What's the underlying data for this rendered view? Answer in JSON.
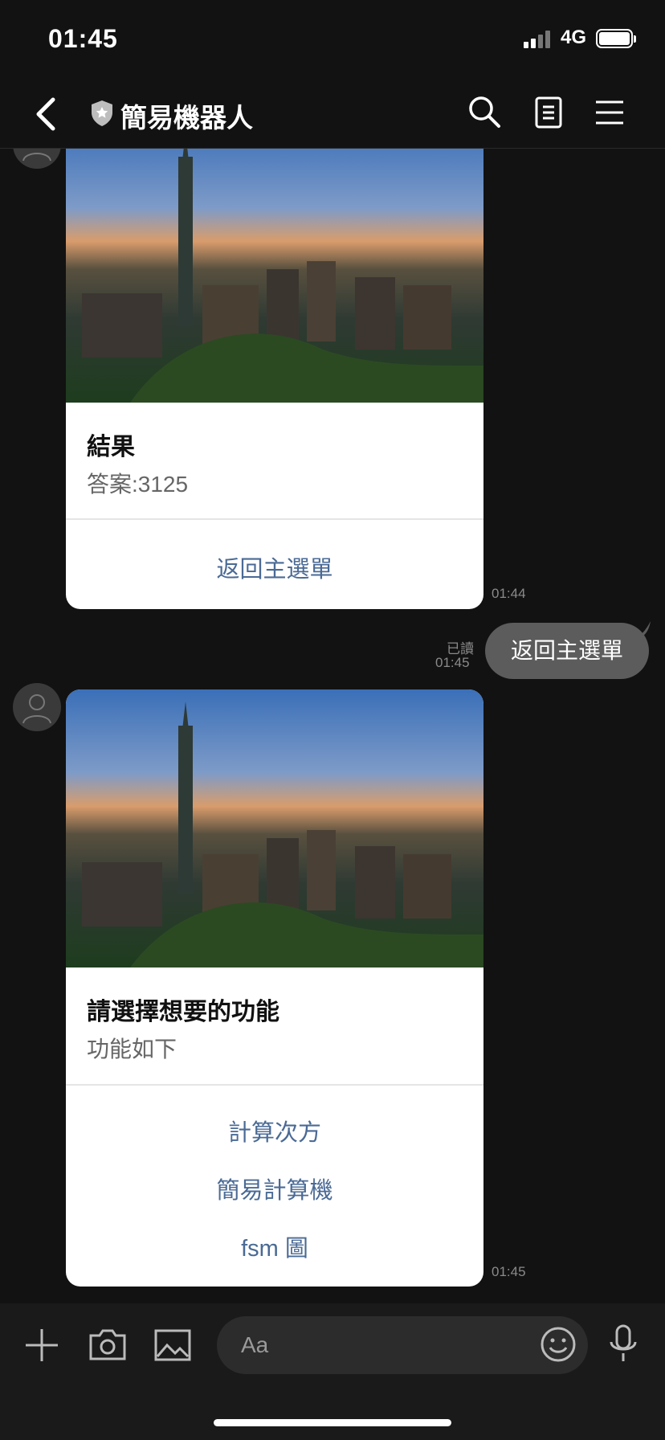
{
  "status": {
    "time": "01:45",
    "network": "4G"
  },
  "header": {
    "title": "簡易機器人"
  },
  "messages": {
    "card1": {
      "title": "結果",
      "subtitle": "答案:3125",
      "action": "返回主選單",
      "time": "01:44"
    },
    "user1": {
      "text": "返回主選單",
      "read": "已讀",
      "time": "01:45"
    },
    "card2": {
      "title": "請選擇想要的功能",
      "subtitle": "功能如下",
      "actions": [
        "計算次方",
        "簡易計算機",
        "fsm 圖"
      ],
      "time": "01:45"
    }
  },
  "input": {
    "placeholder": "Aa"
  },
  "icons": [
    "back-icon",
    "shield-icon",
    "search-icon",
    "notes-icon",
    "menu-icon",
    "avatar-icon",
    "plus-icon",
    "camera-icon",
    "image-icon",
    "emoji-icon",
    "mic-icon"
  ]
}
